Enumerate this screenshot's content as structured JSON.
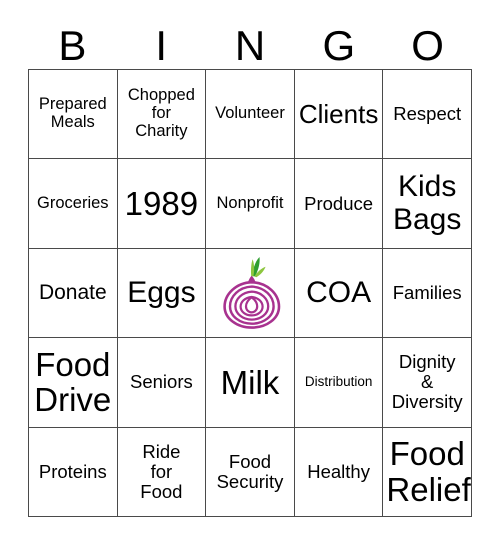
{
  "card": {
    "title": "BINGO",
    "header_letters": [
      "B",
      "I",
      "N",
      "G",
      "O"
    ],
    "grid_size": "5x5",
    "colors": {
      "background": "#ffffff",
      "text": "#000000",
      "border": "#4a4a4a",
      "onion_body": "#a8328f",
      "onion_leaf_dark": "#2f9e2f",
      "onion_leaf_light": "#8dc63f"
    },
    "free_space": {
      "position": "N3",
      "icon": "onion-icon",
      "label": ""
    },
    "columns": {
      "B": [
        "Prepared Meals",
        "Groceries",
        "Donate",
        "Food Drive",
        "Proteins"
      ],
      "I": [
        "Chopped for Charity",
        "1989",
        "Eggs",
        "Seniors",
        "Ride for Food"
      ],
      "N": [
        "Volunteer",
        "Nonprofit",
        "",
        "Milk",
        "Food Security"
      ],
      "G": [
        "Clients",
        "Produce",
        "COA",
        "Distribution",
        "Healthy"
      ],
      "O": [
        "Respect",
        "Kids Bags",
        "Families",
        "Dignity & Diversity",
        "Food Relief"
      ]
    },
    "cells": [
      {
        "id": "B1",
        "text": "Prepared\nMeals",
        "size": "fs-sm"
      },
      {
        "id": "I1",
        "text": "Chopped\nfor\nCharity",
        "size": "fs-sm"
      },
      {
        "id": "N1",
        "text": "Volunteer",
        "size": "fs-sm"
      },
      {
        "id": "G1",
        "text": "Clients",
        "size": "fs-xl"
      },
      {
        "id": "O1",
        "text": "Respect",
        "size": "fs-md"
      },
      {
        "id": "B2",
        "text": "Groceries",
        "size": "fs-sm"
      },
      {
        "id": "I2",
        "text": "1989",
        "size": "fs-max"
      },
      {
        "id": "N2",
        "text": "Nonprofit",
        "size": "fs-sm"
      },
      {
        "id": "G2",
        "text": "Produce",
        "size": "fs-md"
      },
      {
        "id": "O2",
        "text": "Kids\nBags",
        "size": "fs-xxl"
      },
      {
        "id": "B3",
        "text": "Donate",
        "size": "fs-lg"
      },
      {
        "id": "I3",
        "text": "Eggs",
        "size": "fs-xxl"
      },
      {
        "id": "N3",
        "text": "",
        "size": "fs-md"
      },
      {
        "id": "G3",
        "text": "COA",
        "size": "fs-xxl"
      },
      {
        "id": "O3",
        "text": "Families",
        "size": "fs-md"
      },
      {
        "id": "B4",
        "text": "Food\nDrive",
        "size": "fs-max"
      },
      {
        "id": "I4",
        "text": "Seniors",
        "size": "fs-md"
      },
      {
        "id": "N4",
        "text": "Milk",
        "size": "fs-max"
      },
      {
        "id": "G4",
        "text": "Distribution",
        "size": "fs-xs"
      },
      {
        "id": "O4",
        "text": "Dignity\n&\nDiversity",
        "size": "fs-md"
      },
      {
        "id": "B5",
        "text": "Proteins",
        "size": "fs-md"
      },
      {
        "id": "I5",
        "text": "Ride\nfor\nFood",
        "size": "fs-md"
      },
      {
        "id": "N5",
        "text": "Food\nSecurity",
        "size": "fs-md"
      },
      {
        "id": "G5",
        "text": "Healthy",
        "size": "fs-md"
      },
      {
        "id": "O5",
        "text": "Food\nRelief",
        "size": "fs-max"
      }
    ]
  }
}
